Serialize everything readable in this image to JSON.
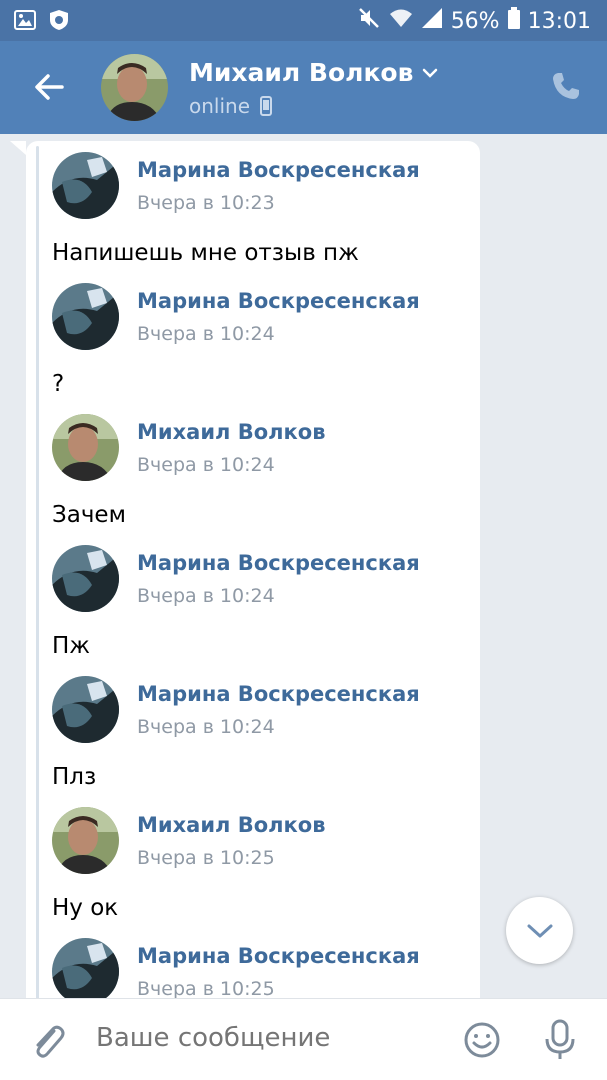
{
  "status_bar": {
    "battery": "56%",
    "time": "13:01"
  },
  "header": {
    "title": "Михаил Волков",
    "status": "online"
  },
  "messages": [
    {
      "sender": "Марина Воскресенская",
      "time": "Вчера в 10:23",
      "text": "Напишешь мне отзыв пж"
    },
    {
      "sender": "Марина Воскресенская",
      "time": "Вчера в 10:24",
      "text": "?"
    },
    {
      "sender": "Михаил Волков",
      "time": "Вчера в 10:24",
      "text": "Зачем"
    },
    {
      "sender": "Марина Воскресенская",
      "time": "Вчера в 10:24",
      "text": "Пж"
    },
    {
      "sender": "Марина Воскресенская",
      "time": "Вчера в 10:24",
      "text": "Плз"
    },
    {
      "sender": "Михаил Волков",
      "time": "Вчера в 10:25",
      "text": "Ну ок"
    },
    {
      "sender": "Марина Воскресенская",
      "time": "Вчера в 10:25",
      "text": ""
    }
  ],
  "composer": {
    "placeholder": "Ваше сообщение"
  },
  "colors": {
    "header": "#5181b8",
    "status_bar": "#4a73a6",
    "name_link": "#3e6a9a",
    "time_gray": "#8f99a5",
    "chat_background": "#e7ebf0"
  }
}
